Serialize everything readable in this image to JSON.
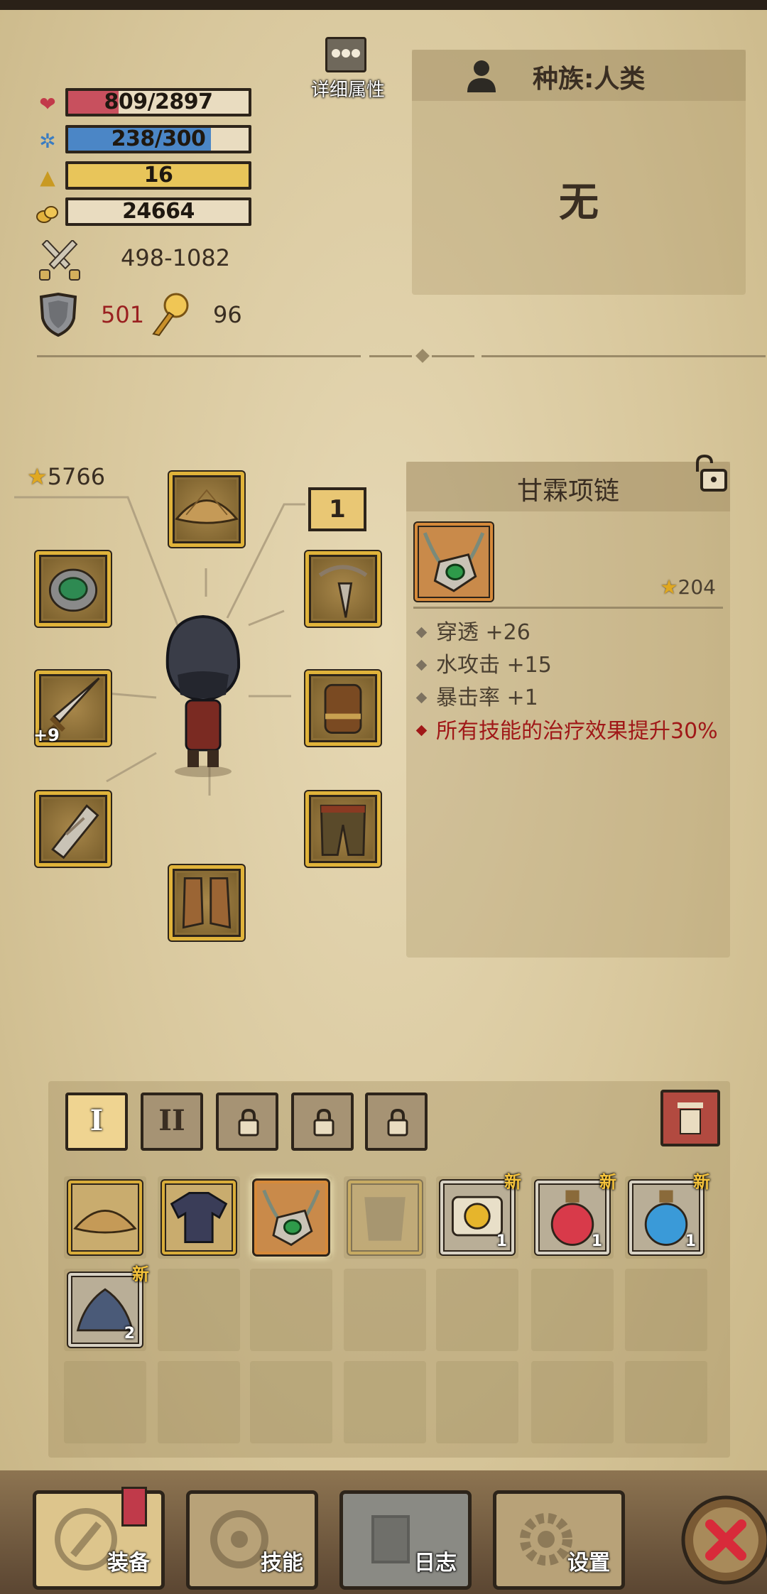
{
  "detail_button": {
    "label": "详细属性",
    "icon": "ellipsis-icon"
  },
  "stats": {
    "hp": {
      "text": "809/2897",
      "ratio": 0.279,
      "color": "#c8505e",
      "icon": "heart-icon"
    },
    "mp": {
      "text": "238/300",
      "ratio": 0.793,
      "color": "#4b86c6",
      "icon": "gear-mana-icon"
    },
    "level": {
      "text": "16",
      "ratio": 1.0,
      "color": "#e8c55a",
      "icon": "triangle-icon"
    },
    "gold": {
      "text": "24664",
      "ratio": 0,
      "color": "#e9dcc0",
      "icon": "gold-icon"
    }
  },
  "attack": {
    "value": "498-1082",
    "icon": "crossed-swords-icon"
  },
  "defense": {
    "value": "501",
    "icon": "shield-icon"
  },
  "magic": {
    "value": "96",
    "icon": "magic-staff-icon"
  },
  "race": {
    "label": "种族:人类",
    "value": "无"
  },
  "equipment": {
    "score": "5766",
    "level_box": "1",
    "weapon_bonus": "+9"
  },
  "item": {
    "name": "甘霖项链",
    "price": "204",
    "attributes": [
      "穿透 +26",
      "水攻击 +15",
      "暴击率 +1"
    ],
    "special": "所有技能的治疗效果提升30%"
  },
  "inventory": {
    "tabs": [
      "I",
      "II"
    ],
    "new_label": "新",
    "counts": {
      "scroll": "1",
      "red_potion": "1",
      "blue_potion": "1",
      "ore": "2"
    }
  },
  "nav": {
    "equip": "装备",
    "skills": "技能",
    "log": "日志",
    "settings": "设置"
  },
  "colors": {
    "accent_gold": "#e0b33a",
    "danger_red": "#a01818",
    "panel": "#d9c9a0"
  }
}
